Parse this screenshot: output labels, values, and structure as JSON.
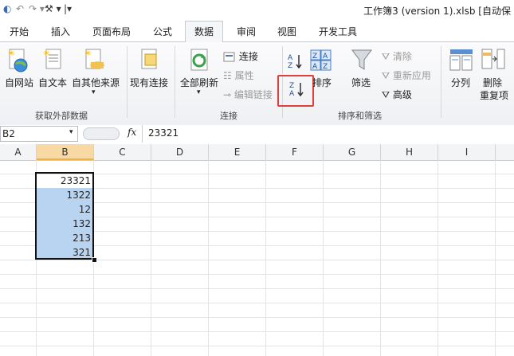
{
  "window": {
    "title": "工作簿3 (version 1).xlsb [自动保"
  },
  "tabs": [
    "开始",
    "插入",
    "页面布局",
    "公式",
    "数据",
    "审阅",
    "视图",
    "开发工具"
  ],
  "active_tab": "数据",
  "ribbon": {
    "get_external": {
      "from_web": "自网站",
      "from_text": "自文本",
      "from_other": "自其他来源",
      "existing": "现有连接",
      "group_label": "获取外部数据"
    },
    "connections": {
      "refresh_all": "全部刷新",
      "connections": "连接",
      "properties": "属性",
      "edit_links": "编辑链接",
      "group_label": "连接"
    },
    "sort_filter": {
      "sort": "排序",
      "filter": "筛选",
      "clear": "清除",
      "reapply": "重新应用",
      "advanced": "高级",
      "group_label": "排序和筛选",
      "az_top": "A",
      "az_bottom": "Z",
      "za_top": "Z",
      "za_bottom": "A"
    },
    "data_tools": {
      "text_to_columns": "分列",
      "remove_dup_line1": "删除",
      "remove_dup_line2": "重复项"
    }
  },
  "formula_bar": {
    "name_box": "B2",
    "fx": "fx",
    "value": "23321"
  },
  "columns": [
    "A",
    "B",
    "C",
    "D",
    "E",
    "F",
    "G",
    "H",
    "I"
  ],
  "selected_column": "B",
  "cells": [
    "23321",
    "1322",
    "12",
    "132",
    "213",
    "321"
  ],
  "colors": {
    "selection_fill": "#b9d4f0",
    "highlight_box": "#e0403a",
    "selected_header": "#f8d9a4"
  }
}
